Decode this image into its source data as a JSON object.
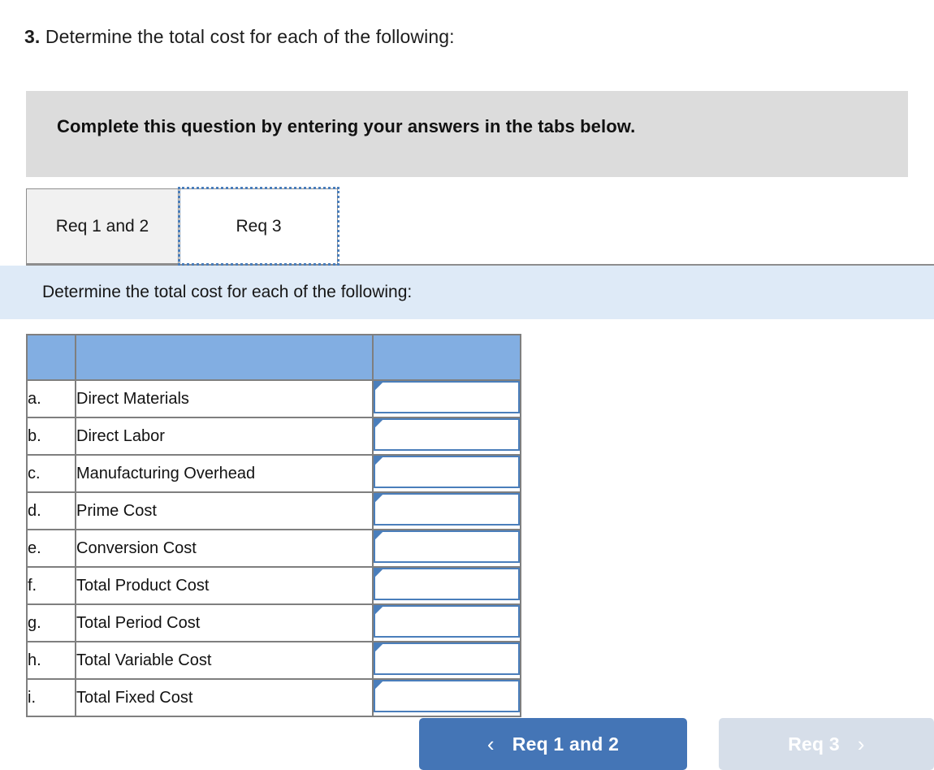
{
  "question": {
    "number": "3.",
    "text": "Determine the total cost for each of the following:"
  },
  "banner": {
    "text": "Complete this question by entering your answers in the tabs below."
  },
  "tabs": [
    {
      "label": "Req 1 and 2",
      "active": false
    },
    {
      "label": "Req 3",
      "active": true
    }
  ],
  "instruction": {
    "text": "Determine the total cost for each of the following:"
  },
  "table": {
    "header": {
      "letter": "",
      "label": "",
      "amount": ""
    },
    "rows": [
      {
        "letter": "a.",
        "label": "Direct Materials",
        "value": ""
      },
      {
        "letter": "b.",
        "label": "Direct Labor",
        "value": ""
      },
      {
        "letter": "c.",
        "label": "Manufacturing Overhead",
        "value": ""
      },
      {
        "letter": "d.",
        "label": "Prime Cost",
        "value": ""
      },
      {
        "letter": "e.",
        "label": "Conversion Cost",
        "value": ""
      },
      {
        "letter": "f.",
        "label": "Total Product Cost",
        "value": ""
      },
      {
        "letter": "g.",
        "label": "Total Period Cost",
        "value": ""
      },
      {
        "letter": "h.",
        "label": "Total Variable Cost",
        "value": ""
      },
      {
        "letter": "i.",
        "label": "Total Fixed Cost",
        "value": ""
      }
    ]
  },
  "navigation": {
    "prev": {
      "label": "Req 1 and 2",
      "icon": "chevron-left",
      "glyph": "‹",
      "enabled": true
    },
    "next": {
      "label": "Req 3",
      "icon": "chevron-right",
      "glyph": "›",
      "enabled": false
    }
  },
  "colors": {
    "banner_gray": "#dcdcdc",
    "strip_blue": "#deeaf7",
    "table_header_blue": "#82aee2",
    "input_border_blue": "#4a7ebb",
    "nav_primary": "#4475b6",
    "nav_disabled": "#d6dee9",
    "tab_inactive": "#f1f1f1",
    "border_gray": "#7f7f7f"
  }
}
